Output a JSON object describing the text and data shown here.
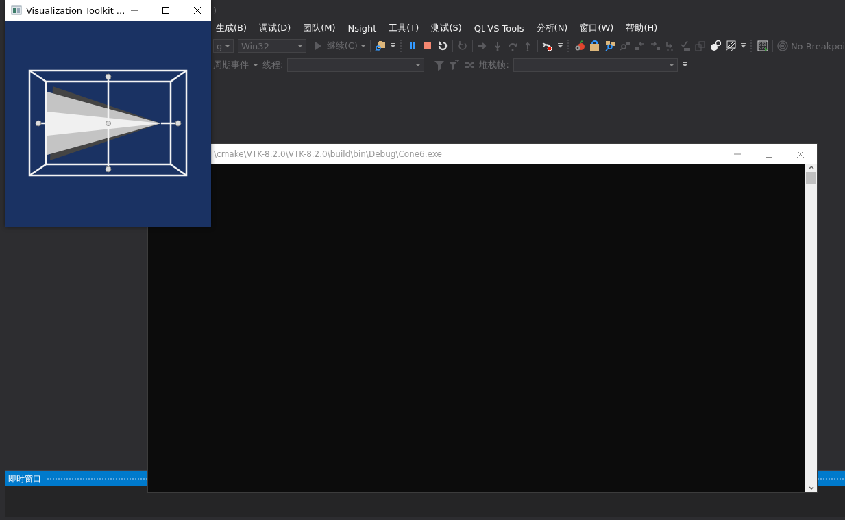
{
  "ide": {
    "title_fragment": ")",
    "menu": [
      "生成(B)",
      "调试(D)",
      "团队(M)",
      "Nsight",
      "工具(T)",
      "测试(S)",
      "Qt VS Tools",
      "分析(N)",
      "窗口(W)",
      "帮助(H)"
    ],
    "toolbar": {
      "configuration": "g",
      "platform": "Win32",
      "continue": "继续(C)",
      "breakpoints": "No Breakpoi"
    },
    "debug_location": {
      "event_label": "周期事件",
      "thread_label": "线程:",
      "stack_frame_label": "堆栈帧:"
    },
    "tool_window": {
      "title": "即时窗口"
    }
  },
  "console_window": {
    "title": "\\cmake\\VTK-8.2.0\\VTK-8.2.0\\build\\bin\\Debug\\Cone6.exe"
  },
  "vtk_window": {
    "title": "Visualization Toolkit ..."
  }
}
